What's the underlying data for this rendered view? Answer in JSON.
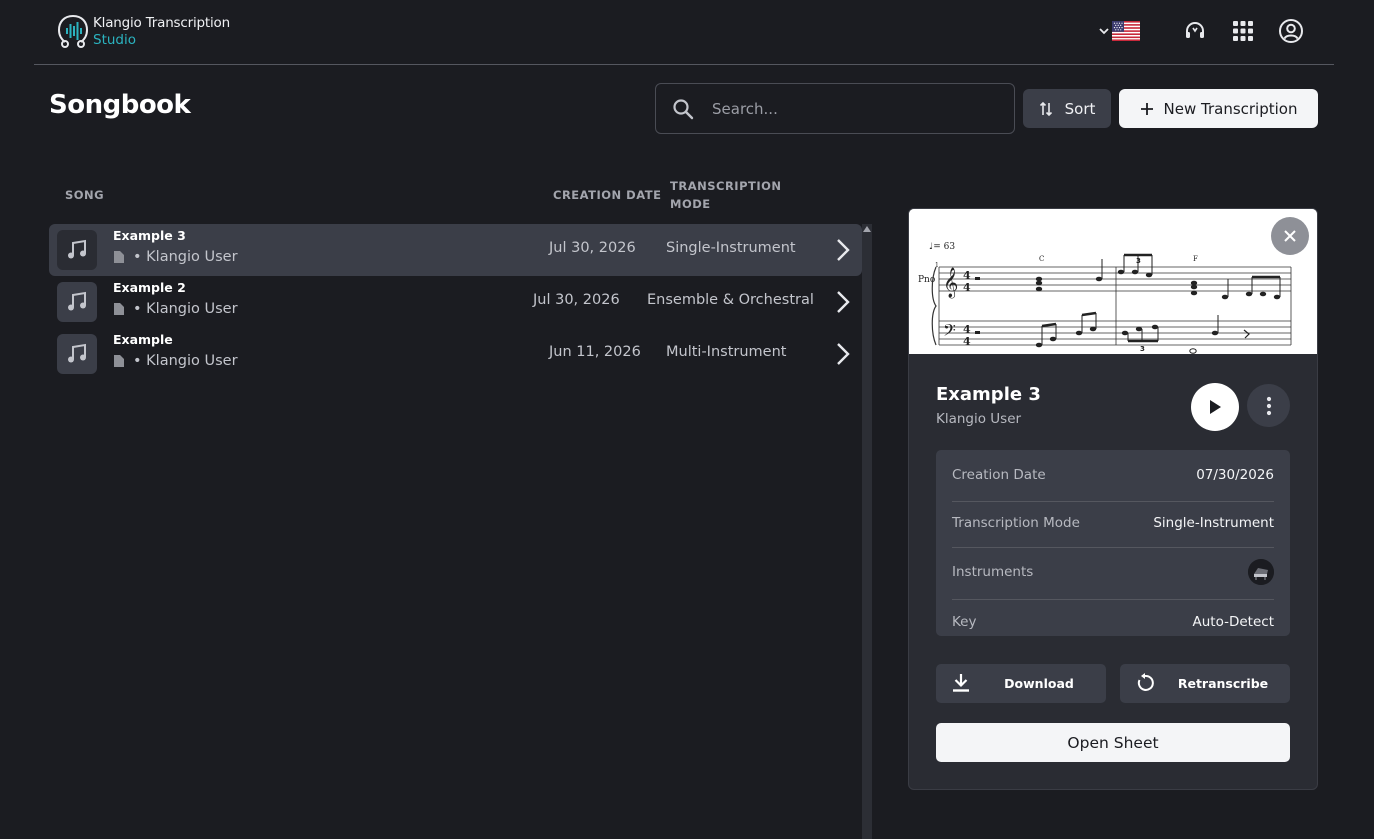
{
  "app": {
    "name_line1": "Klangio Transcription",
    "name_line2": "Studio"
  },
  "header": {
    "language_icon": "us-flag-icon",
    "icons": [
      "headset-icon",
      "apps-grid-icon",
      "account-icon"
    ]
  },
  "page": {
    "title": "Songbook"
  },
  "toolbar": {
    "search_placeholder": "Search...",
    "sort_label": "Sort",
    "new_label": "New Transcription"
  },
  "table": {
    "headers": {
      "song": "SONG",
      "date": "CREATION DATE",
      "mode_line1": "TRANSCRIPTION",
      "mode_line2": "MODE"
    },
    "rows": [
      {
        "name": "Example 3",
        "owner": "• Klangio User",
        "date": "Jul 30, 2026",
        "mode": "Single-Instrument",
        "selected": true
      },
      {
        "name": "Example 2",
        "owner": "• Klangio User",
        "date": "Jul 30, 2026",
        "mode": "Ensemble & Orchestral",
        "selected": false
      },
      {
        "name": "Example",
        "owner": "• Klangio User",
        "date": "Jun 11, 2026",
        "mode": "Multi-Instrument",
        "selected": false
      }
    ]
  },
  "detail": {
    "sheet": {
      "tempo": "♩= 63",
      "instrument_abbr": "Pno",
      "chord1": "C",
      "chord2": "F",
      "measure": "1"
    },
    "title": "Example 3",
    "author": "Klangio User",
    "info": {
      "date_label": "Creation Date",
      "date_value": "07/30/2026",
      "mode_label": "Transcription Mode",
      "mode_value": "Single-Instrument",
      "instruments_label": "Instruments",
      "instrument_icon": "piano-icon",
      "key_label": "Key",
      "key_value": "Auto-Detect"
    },
    "download_label": "Download",
    "retranscribe_label": "Retranscribe",
    "open_sheet_label": "Open Sheet"
  },
  "colors": {
    "background": "#1b1c21",
    "panel": "#2a2c33",
    "accent": "#2bb3c0",
    "selected_row": "#3b3e48"
  }
}
